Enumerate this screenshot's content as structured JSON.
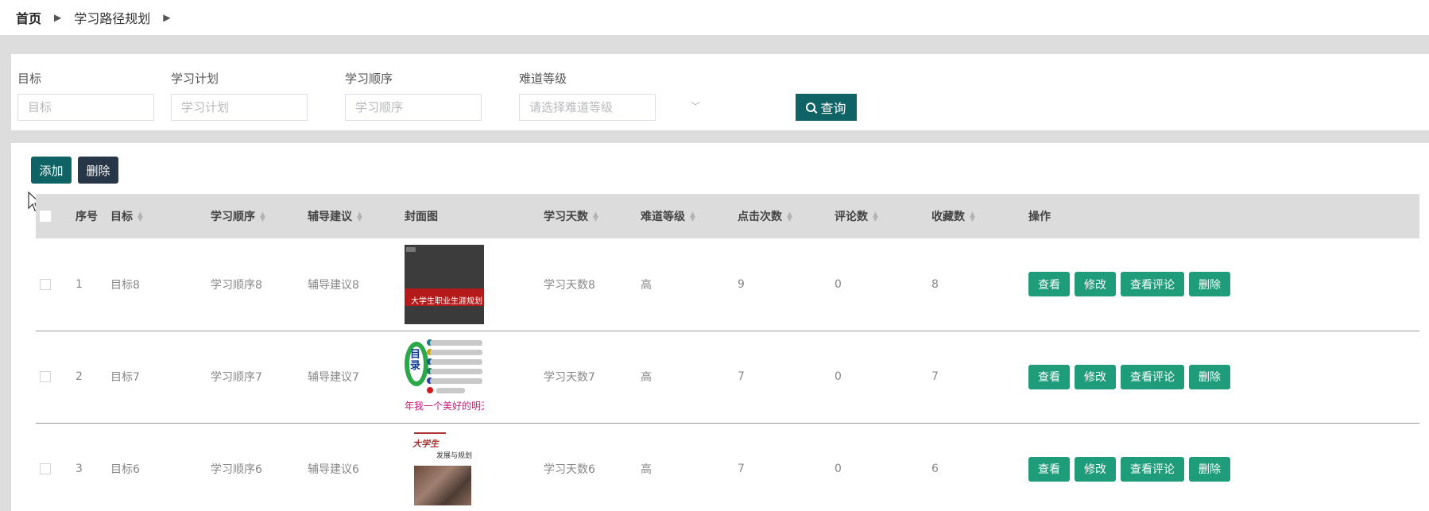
{
  "breadcrumb": {
    "home": "首页",
    "current": "学习路径规划"
  },
  "search": {
    "goal_label": "目标",
    "goal_placeholder": "目标",
    "plan_label": "学习计划",
    "plan_placeholder": "学习计划",
    "order_label": "学习顺序",
    "order_placeholder": "学习顺序",
    "difficulty_label": "难道等级",
    "difficulty_placeholder": "请选择难道等级",
    "query_label": "查询"
  },
  "toolbar": {
    "add_label": "添加",
    "delete_label": "删除"
  },
  "table": {
    "headers": [
      "序号",
      "目标",
      "学习顺序",
      "辅导建议",
      "封面图",
      "学习天数",
      "难道等级",
      "点击次数",
      "评论数",
      "收藏数",
      "操作"
    ],
    "rows": [
      {
        "index": "1",
        "goal": "目标8",
        "order": "学习顺序8",
        "advice": "辅导建议8",
        "cover_text": "大学生职业生涯规划",
        "days": "学习天数8",
        "difficulty": "高",
        "clicks": "9",
        "comments": "0",
        "favorites": "8"
      },
      {
        "index": "2",
        "goal": "目标7",
        "order": "学习顺序7",
        "advice": "辅导建议7",
        "cover_text": "年我一个美好的明天",
        "cover_mark": "目录",
        "days": "学习天数7",
        "difficulty": "高",
        "clicks": "7",
        "comments": "0",
        "favorites": "7"
      },
      {
        "index": "3",
        "goal": "目标6",
        "order": "学习顺序6",
        "advice": "辅导建议6",
        "cover_text": "大学生",
        "cover_sub": "发展与规划",
        "days": "学习天数6",
        "difficulty": "高",
        "clicks": "7",
        "comments": "0",
        "favorites": "6"
      }
    ],
    "actions": {
      "view": "查看",
      "edit": "修改",
      "view_comments": "查看评论",
      "delete": "删除"
    }
  },
  "colors": {
    "primary": "#0f6364",
    "dark": "#283747",
    "action": "#1f9c7a"
  }
}
